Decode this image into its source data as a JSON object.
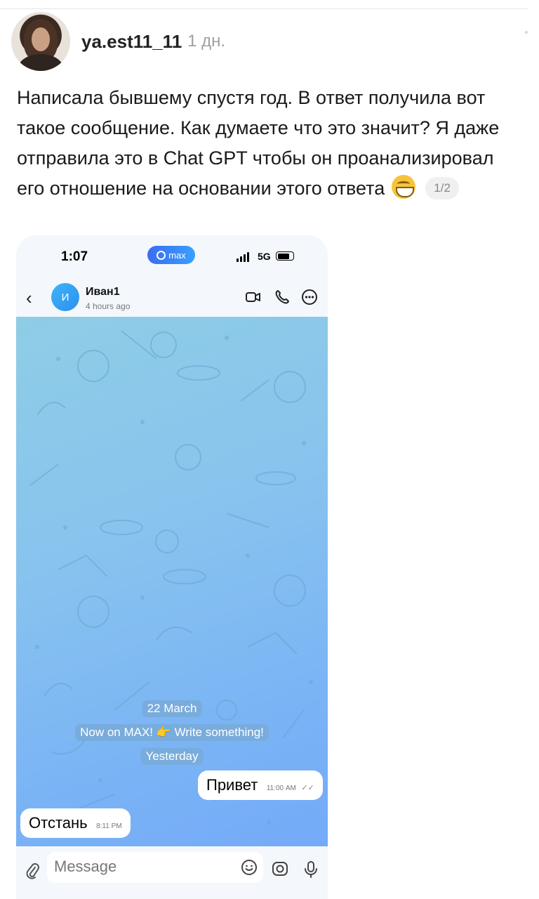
{
  "post": {
    "username": "ya.est11_11",
    "time": "1 дн.",
    "text": "Написала бывшему спустя год. В ответ получила вот такое сообщение. Как думаете что это значит? Я даже отправила это в Chat GPT чтобы он проанализировал его отношение на основании этого ответа",
    "emoji": "grinning-face-emoji",
    "pager": "1/2"
  },
  "phone": {
    "status": {
      "time": "1:07",
      "app_badge": "max",
      "network": "5G",
      "battery_level": 0.8
    },
    "chat": {
      "contact_initial": "И",
      "contact_name": "Иван1",
      "contact_status": "4 hours ago",
      "icons": [
        "back-icon",
        "video-call-icon",
        "phone-call-icon",
        "more-icon"
      ]
    },
    "system_messages": {
      "date1": "22 March",
      "notice": "Now on MAX! 👉 Write something!",
      "date2": "Yesterday"
    },
    "messages": [
      {
        "direction": "outgoing",
        "text": "Привет",
        "time": "11:00 AM",
        "read": true
      },
      {
        "direction": "incoming",
        "text": "Отстань",
        "time": "8:11 PM"
      }
    ],
    "composer": {
      "placeholder": "Message",
      "icons": [
        "attach-icon",
        "emoji-icon",
        "camera-icon",
        "microphone-icon"
      ]
    }
  },
  "colors": {
    "chat_bg_top": "#8fcde6",
    "chat_bg_bottom": "#74aaf8",
    "max_brand": "#3a6cf0",
    "bubble": "#ffffff"
  }
}
